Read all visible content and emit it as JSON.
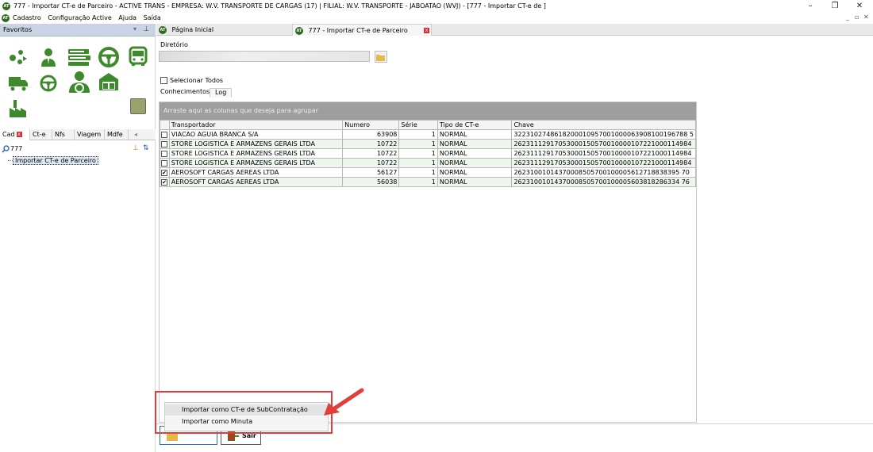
{
  "window": {
    "title": "777 - Importar CT-e de Parceiro - ACTIVE TRANS - EMPRESA: W.V. TRANSPORTE DE CARGAS (17) | FILIAL: W.V. TRANSPORTE - JABOATAO (WVJ) - [777 - Importar CT-e de ]",
    "logo_text": "AT"
  },
  "menu": [
    "Cadastro",
    "Configuração Active",
    "Ajuda",
    "Saída"
  ],
  "favorites": {
    "title": "Favoritos",
    "icons": [
      "routing-icon",
      "person-icon",
      "buses-icon",
      "steering-wheel-icon",
      "bus-front-icon",
      "truck-icon",
      "steering-wheel-small-icon",
      "driver-icon",
      "warehouse-icon",
      "factory-icon",
      "trash-icon"
    ]
  },
  "left_tabs": [
    "Cad",
    "Ct-e",
    "Nfs",
    "Viagem",
    "Mdfe"
  ],
  "search": {
    "value": "777"
  },
  "tree": {
    "item": "Importar CT-e de Parceiro"
  },
  "doc_tabs": [
    "Página Inicial",
    "777 - Importar CT-e de Parceiro"
  ],
  "form": {
    "dir_label": "Diretório",
    "select_all": "Selecionar Todos",
    "tabs": [
      "Conhecimentos",
      "Log"
    ]
  },
  "grid": {
    "group_hint": "Arraste aqui as colunas que deseja para agrupar",
    "columns": [
      "Transportador",
      "Numero",
      "Série",
      "Tipo de CT-e",
      "Chave"
    ],
    "rows": [
      {
        "checked": false,
        "transportador": "VIACAO AGUIA BRANCA S/A",
        "numero": "63908",
        "serie": "1",
        "tipo": "NORMAL",
        "chave": "3223102748618200010957001000063908100196788 5"
      },
      {
        "checked": false,
        "transportador": "STORE LOGISTICA E ARMAZENS GERAIS LTDA",
        "numero": "10722",
        "serie": "1",
        "tipo": "NORMAL",
        "chave": "26231112917053000150570010000107221000114984"
      },
      {
        "checked": false,
        "transportador": "STORE LOGISTICA E ARMAZENS GERAIS LTDA",
        "numero": "10722",
        "serie": "1",
        "tipo": "NORMAL",
        "chave": "26231112917053000150570010000107221000114984"
      },
      {
        "checked": false,
        "transportador": "STORE LOGISTICA E ARMAZENS GERAIS LTDA",
        "numero": "10722",
        "serie": "1",
        "tipo": "NORMAL",
        "chave": "26231112917053000150570010000107221000114984"
      },
      {
        "checked": true,
        "transportador": "AEROSOFT CARGAS AEREAS LTDA",
        "numero": "56127",
        "serie": "1",
        "tipo": "NORMAL",
        "chave": "26231001014370008505700100005612718838395 70"
      },
      {
        "checked": true,
        "transportador": "AEROSOFT CARGAS AEREAS LTDA",
        "numero": "56038",
        "serie": "1",
        "tipo": "NORMAL",
        "chave": "26231001014370008505700100005603818286334 76"
      }
    ]
  },
  "popup": [
    "Importar como CT-e de SubContratação",
    "Importar como Minuta"
  ],
  "buttons": {
    "exit": "Sair"
  },
  "colors": {
    "highlight_box": "#e63c3c",
    "arrow": "#e0403a",
    "fav_header": "#c8d4e4",
    "icon_green": "#3d8a2c"
  }
}
